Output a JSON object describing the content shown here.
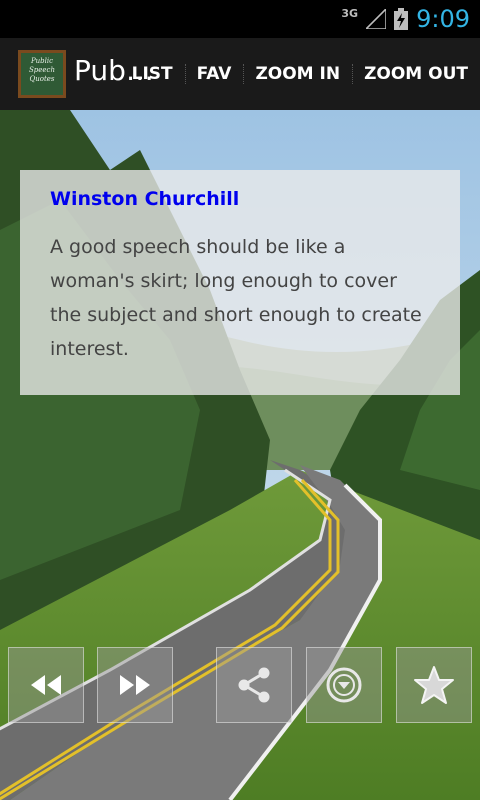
{
  "status_bar": {
    "network": "3G",
    "time": "9:09",
    "colors": {
      "clock": "#33b5e5"
    },
    "icons": [
      "signal-icon",
      "battery-icon"
    ]
  },
  "action_bar": {
    "app_icon_text": "Public Speech Quotes",
    "title": "Pub…",
    "menu": [
      {
        "label": "LIST"
      },
      {
        "label": "FAV"
      },
      {
        "label": "ZOOM IN"
      },
      {
        "label": "ZOOM OUT"
      }
    ]
  },
  "quote": {
    "author": "Winston Churchill",
    "text": "A good speech should be like a woman's skirt; long enough to cover the subject and short enough to create interest.",
    "colors": {
      "author": "#0000ee",
      "text": "#444444"
    }
  },
  "bottom_controls": [
    {
      "icon": "rewind-icon"
    },
    {
      "icon": "fast-forward-icon"
    },
    {
      "icon": "share-icon"
    },
    {
      "icon": "dropdown-circle-icon"
    },
    {
      "icon": "star-icon"
    }
  ]
}
